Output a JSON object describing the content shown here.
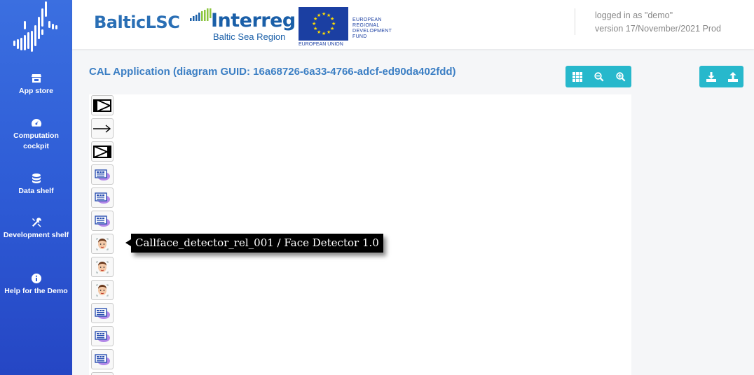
{
  "app": {
    "title": "BalticLSC"
  },
  "sidebar": {
    "items": [
      {
        "label": "App store",
        "icon": "store-icon"
      },
      {
        "label": "Computation cockpit",
        "icon": "speedometer-icon"
      },
      {
        "label": "Data shelf",
        "icon": "database-icon"
      },
      {
        "label": "Development shelf",
        "icon": "tools-icon"
      },
      {
        "label": "Help for the Demo",
        "icon": "info-icon"
      }
    ]
  },
  "header": {
    "brand": "BalticLSC",
    "interreg": {
      "word": "Interreg",
      "sub": "Baltic Sea Region"
    },
    "eu": {
      "caption": "EUROPEAN UNION",
      "fund_lines": [
        "EUROPEAN",
        "REGIONAL",
        "DEVELOPMENT",
        "FUND"
      ]
    },
    "login_line": "logged in as \"demo\"",
    "version_line": "version 17/November/2021 Prod"
  },
  "main": {
    "title": "CAL Application (diagram GUID: 16a68726-6a33-4766-adcf-ed90da402fdd)",
    "toolbar_left": [
      "grid-icon",
      "zoom-out-icon",
      "zoom-in-icon"
    ],
    "toolbar_right": [
      "download-icon",
      "upload-icon"
    ]
  },
  "palette": {
    "items": [
      {
        "type": "input-pin",
        "icon": "input-pin-icon"
      },
      {
        "type": "data-flow",
        "icon": "arrow-icon"
      },
      {
        "type": "output-pin",
        "icon": "output-pin-icon"
      },
      {
        "type": "module",
        "icon": "module-icon"
      },
      {
        "type": "module",
        "icon": "module-icon"
      },
      {
        "type": "module",
        "icon": "module-icon"
      },
      {
        "type": "face-detector",
        "icon": "face-icon"
      },
      {
        "type": "face-detector",
        "icon": "face-icon"
      },
      {
        "type": "face-detector",
        "icon": "face-icon"
      },
      {
        "type": "module",
        "icon": "module-icon"
      },
      {
        "type": "module",
        "icon": "module-icon"
      },
      {
        "type": "module",
        "icon": "module-icon"
      }
    ]
  },
  "tooltip": {
    "text": "Callface_detector_rel_001 / Face Detector 1.0"
  },
  "colors": {
    "sidebar": "#2e5cd6",
    "accent": "#27b8cc",
    "title": "#3c7fc4"
  }
}
